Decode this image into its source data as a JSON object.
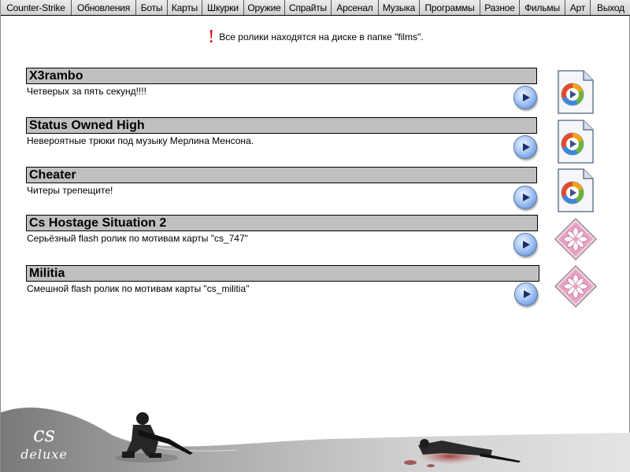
{
  "nav": {
    "tabs": [
      {
        "label": "Counter-Strike"
      },
      {
        "label": "Обновления"
      },
      {
        "label": "Боты"
      },
      {
        "label": "Карты"
      },
      {
        "label": "Шкурки"
      },
      {
        "label": "Оружие"
      },
      {
        "label": "Спрайты"
      },
      {
        "label": "Арсенал"
      },
      {
        "label": "Музыка"
      },
      {
        "label": "Программы"
      },
      {
        "label": "Разное"
      },
      {
        "label": "Фильмы"
      },
      {
        "label": "Арт"
      },
      {
        "label": "Выход"
      }
    ],
    "active_tab": "Фильмы"
  },
  "notice": {
    "mark": "!",
    "text": "Все ролики находятся на диске в папке \"films\"."
  },
  "films": [
    {
      "title": "X3rambo",
      "description": "Четверых за пять секунд!!!!",
      "file_icon": "media-player-file-icon"
    },
    {
      "title": "Status Owned High",
      "description": "Невероятные трюки под музыку Мерлина Менсона.",
      "file_icon": "media-player-file-icon"
    },
    {
      "title": "Cheater",
      "description": "Читеры трепещите!",
      "file_icon": "media-player-file-icon"
    },
    {
      "title": "Cs Hostage Situation 2",
      "description": "Серьёзный flash ролик по мотивам карты \"cs_747\"",
      "file_icon": "flash-file-icon"
    },
    {
      "title": "Militia",
      "description": "Смешной flash ролик по мотивам карты \"cs_militia\"",
      "file_icon": "flash-file-icon"
    }
  ],
  "footer": {
    "logo_line1": "cs",
    "logo_line2": "deluxe"
  },
  "colors": {
    "title_bar": "#c0c0c0",
    "notice_mark": "#d80000",
    "play_button": "#8fb3ea",
    "footer_bg": "#8c8c8c"
  }
}
